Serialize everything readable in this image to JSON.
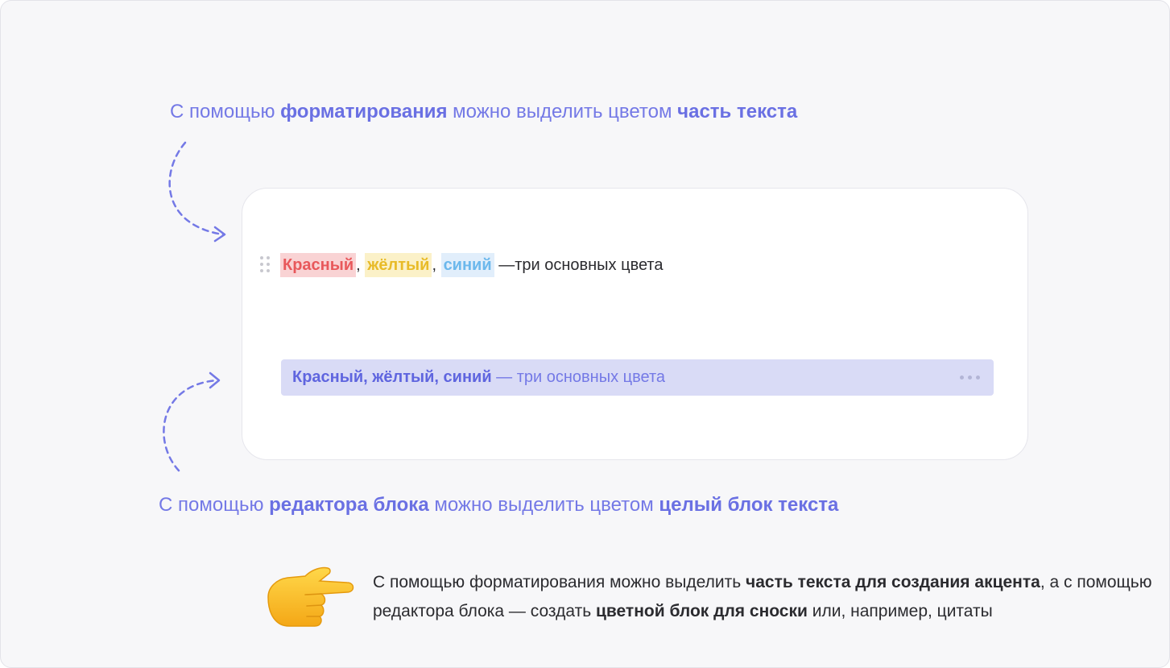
{
  "top_caption": {
    "p1": "С помощью ",
    "b1": "форматирования",
    "p2": " можно выделить цветом ",
    "b2": "часть текста"
  },
  "card": {
    "line1": {
      "red": "Красный",
      "comma1": ",",
      "yellow": "жёлтый",
      "comma2": ",",
      "blue": "синий",
      "rest": " —три основных цвета"
    },
    "block": {
      "bold": "Красный, жёлтый, синий",
      "rest": " — три основных цвета"
    }
  },
  "bottom_caption": {
    "p1": "С помощью ",
    "b1": "редактора блока",
    "p2": " можно выделить цветом ",
    "b2": "целый блок текста"
  },
  "note": {
    "t1": "С помощью форматирования можно выделить ",
    "b1": "часть текста для создания акцента",
    "t2": ", а с помощью редактора блока — создать ",
    "b2": "цветной блок для сноски",
    "t3": " или, например, цитаты"
  },
  "colors": {
    "accent": "#7479e6",
    "red": "#e8585b",
    "yellow": "#e8bb28",
    "blue": "#6cb8ec",
    "block_bg": "#d9dbf6"
  },
  "icons": {
    "drag": "drag-handle-icon",
    "more": "more-dots-icon",
    "hand": "pointing-hand-emoji"
  }
}
